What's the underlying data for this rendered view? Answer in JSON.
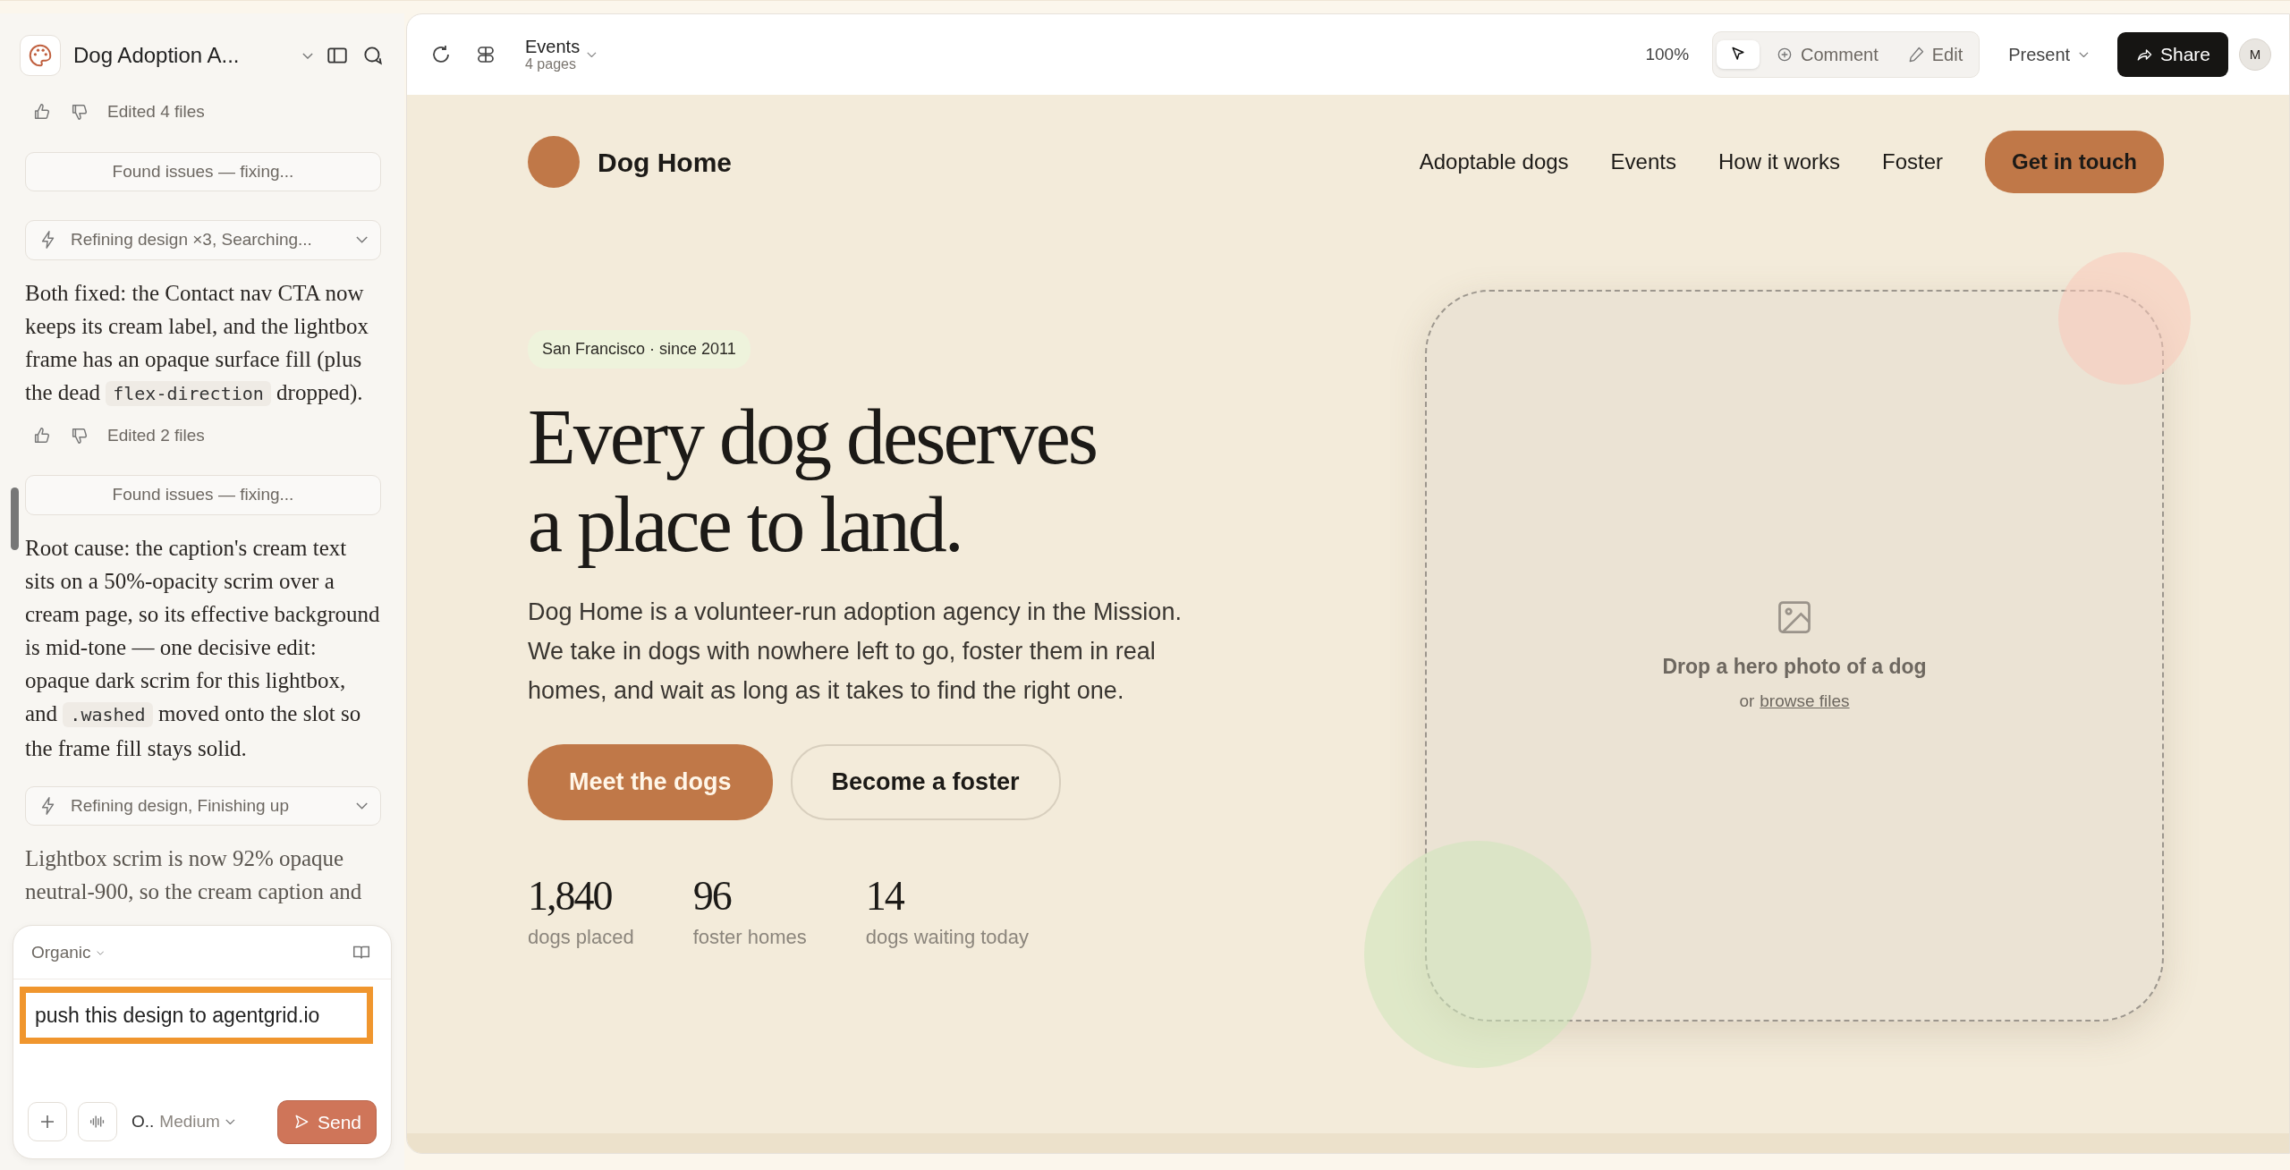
{
  "sidebar": {
    "project_title": "Dog Adoption A...",
    "chat": [
      {
        "kind": "feedback",
        "label": "Edited 4 files"
      },
      {
        "kind": "status",
        "label": "Found issues — fixing..."
      },
      {
        "kind": "activity",
        "label": "Refining design ×3, Searching..."
      },
      {
        "kind": "message",
        "parts": [
          {
            "text": "Both fixed: the Contact nav CTA now keeps its cream label, and the lightbox frame has an opaque surface fill (plus the dead "
          },
          {
            "code": "flex-direction"
          },
          {
            "text": " dropped)."
          }
        ]
      },
      {
        "kind": "feedback",
        "label": "Edited 2 files"
      },
      {
        "kind": "status",
        "label": "Found issues — fixing..."
      },
      {
        "kind": "message",
        "parts": [
          {
            "text": "Root cause: the caption's cream text sits on a 50%-opacity scrim over a cream page, so its effective background is mid-tone — one decisive edit: opaque dark scrim for this lightbox, and "
          },
          {
            "code": ".washed"
          },
          {
            "text": " moved onto the slot so the frame fill stays solid."
          }
        ]
      },
      {
        "kind": "activity",
        "label": "Refining design, Finishing up"
      },
      {
        "kind": "message",
        "parts": [
          {
            "text": "Lightbox scrim is now 92% opaque neutral-900, so the cream caption and"
          }
        ]
      }
    ],
    "composer": {
      "style": "Organic",
      "value": "push this design to agentgrid.io",
      "highlighted": true,
      "model": "O..",
      "effort": "Medium",
      "send": "Send"
    }
  },
  "toolbar": {
    "page": "Events",
    "page_count": "4 pages",
    "zoom": "100%",
    "modes": [
      {
        "kind": "pointer",
        "selected": true
      },
      {
        "kind": "comment",
        "label": "Comment",
        "selected": false
      },
      {
        "kind": "edit",
        "label": "Edit",
        "selected": false
      }
    ],
    "present": "Present",
    "share": "Share",
    "avatar": "M"
  },
  "site": {
    "brand": "Dog Home",
    "nav": [
      "Adoptable dogs",
      "Events",
      "How it works",
      "Foster"
    ],
    "cta": "Get in touch",
    "tag": "San Francisco · since 2011",
    "headline": [
      "Every dog deserves",
      "a place to land."
    ],
    "lede": "Dog Home is a volunteer-run adoption agency in the Mission. We take in dogs with nowhere left to go, foster them in real homes, and wait as long as it takes to find the right one.",
    "buttons": [
      {
        "kind": "primary",
        "label": "Meet the dogs"
      },
      {
        "kind": "outline",
        "label": "Become a foster"
      }
    ],
    "stats": [
      {
        "value": "1,840",
        "label": "dogs placed"
      },
      {
        "value": "96",
        "label": "foster homes"
      },
      {
        "value": "14",
        "label": "dogs waiting today"
      }
    ],
    "dropzone": {
      "title": "Drop a hero photo of a dog",
      "prefix": "or",
      "link": "browse files"
    }
  }
}
